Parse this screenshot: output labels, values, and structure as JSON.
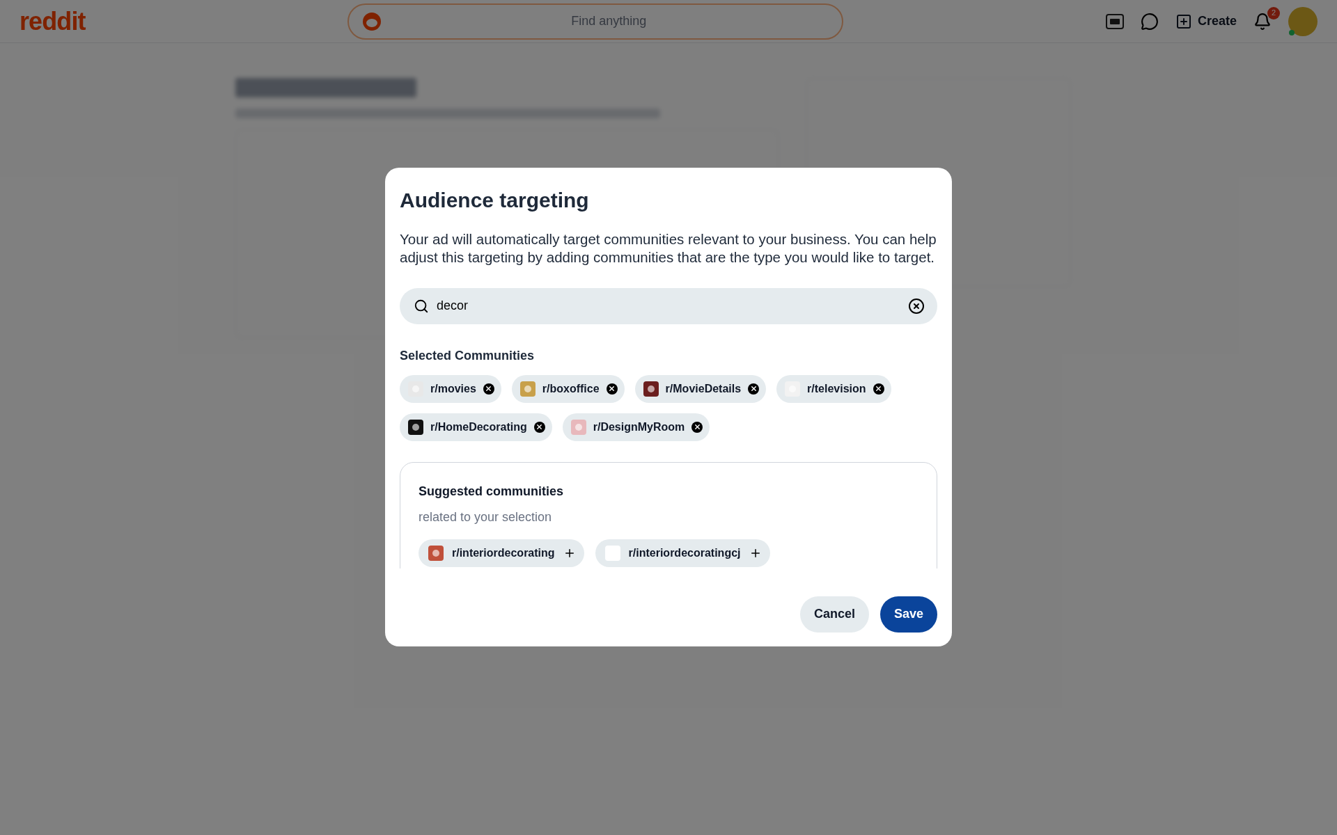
{
  "header": {
    "logo": "reddit",
    "search_placeholder": "Find anything",
    "create_label": "Create",
    "notification_count": "2"
  },
  "dialog": {
    "title": "Audience targeting",
    "description": "Your ad will automatically target communities relevant to your business. You can help adjust this targeting by adding communities that are the type you would like to target.",
    "search": {
      "value": "decor"
    },
    "selected_heading": "Selected Communities",
    "selected_communities": [
      {
        "name": "r/movies",
        "color": "#e8e8e8"
      },
      {
        "name": "r/boxoffice",
        "color": "#c8a04a"
      },
      {
        "name": "r/MovieDetails",
        "color": "#6b1e1e"
      },
      {
        "name": "r/television",
        "color": "#f2f2f2"
      },
      {
        "name": "r/HomeDecorating",
        "color": "#111111"
      },
      {
        "name": "r/DesignMyRoom",
        "color": "#e8b8bc"
      }
    ],
    "suggested": {
      "title": "Suggested communities",
      "subtitle": "related to your selection",
      "communities": [
        {
          "name": "r/interiordecorating",
          "color": "#c0503a"
        },
        {
          "name": "r/interiordecoratingcj",
          "color": "#ffffff"
        }
      ]
    },
    "buttons": [
      {
        "label": "Cancel",
        "kind": "secondary"
      },
      {
        "label": "Save",
        "kind": "primary"
      }
    ]
  }
}
